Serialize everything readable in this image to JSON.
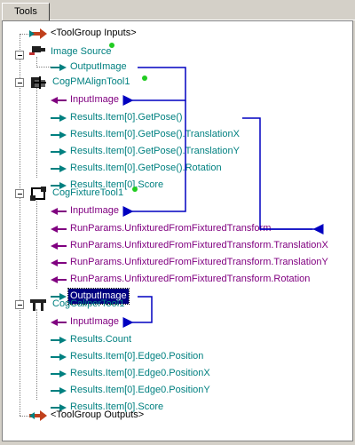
{
  "tab": {
    "label": "Tools"
  },
  "tree": {
    "group_inputs": "<ToolGroup Inputs>",
    "image_source": {
      "label": "Image Source",
      "output": "OutputImage"
    },
    "pmalign": {
      "label": "CogPMAlignTool1",
      "input": "InputImage",
      "outputs": [
        "Results.Item[0].GetPose()",
        "Results.Item[0].GetPose().TranslationX",
        "Results.Item[0].GetPose().TranslationY",
        "Results.Item[0].GetPose().Rotation",
        "Results.Item[0].Score"
      ]
    },
    "fixture": {
      "label": "CogFixtureTool1",
      "input": "InputImage",
      "params": [
        "RunParams.UnfixturedFromFixturedTransform",
        "RunParams.UnfixturedFromFixturedTransform.TranslationX",
        "RunParams.UnfixturedFromFixturedTransform.TranslationY",
        "RunParams.UnfixturedFromFixturedTransform.Rotation"
      ],
      "output": "OutputImage"
    },
    "caliper": {
      "label": "CogCaliperTool1",
      "input": "InputImage",
      "outputs": [
        "Results.Count",
        "Results.Item[0].Edge0.Position",
        "Results.Item[0].Edge0.PositionX",
        "Results.Item[0].Edge0.PositionY",
        "Results.Item[0].Score"
      ]
    },
    "group_outputs": "<ToolGroup Outputs>"
  },
  "colors": {
    "input_arrow": "#800080",
    "output_arrow": "#008080",
    "link_line": "#0000c0",
    "status_ok": "#22cc22"
  }
}
